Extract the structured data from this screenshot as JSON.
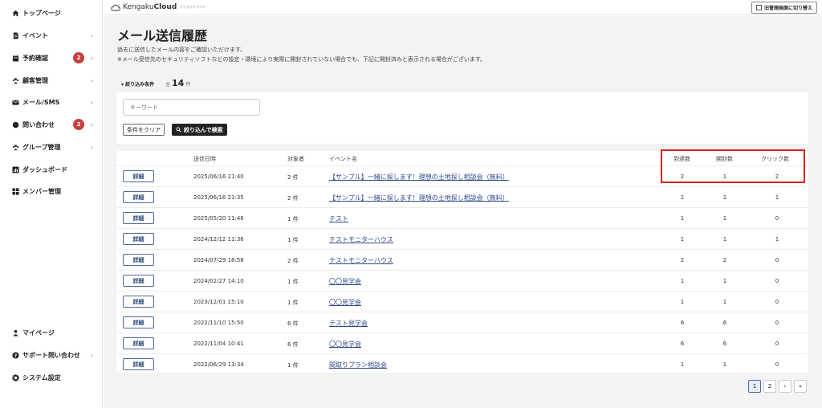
{
  "sidebar": {
    "items": [
      {
        "label": "トップページ",
        "icon": "home-icon"
      },
      {
        "label": "イベント",
        "icon": "document-icon",
        "chevron": "›"
      },
      {
        "label": "予約確認",
        "icon": "calendar-icon",
        "badge": "2",
        "chevron": "›"
      },
      {
        "label": "顧客管理",
        "icon": "users-icon",
        "chevron": "›"
      },
      {
        "label": "メール/SMS",
        "icon": "mail-icon",
        "chevron": "›"
      },
      {
        "label": "問い合わせ",
        "icon": "chat-icon",
        "badge": "2",
        "chevron": "›"
      },
      {
        "label": "グループ管理",
        "icon": "group-icon",
        "chevron": "›"
      },
      {
        "label": "ダッシュボード",
        "icon": "chart-icon"
      },
      {
        "label": "メンバー管理",
        "icon": "grid-icon"
      }
    ],
    "bottom_items": [
      {
        "label": "マイページ",
        "icon": "person-icon"
      },
      {
        "label": "サポート問い合わせ",
        "icon": "help-icon",
        "chevron": "›"
      },
      {
        "label": "システム設定",
        "icon": "gear-icon"
      }
    ]
  },
  "header": {
    "logo_main": "Kengaku",
    "logo_bold": "Cloud",
    "logo_sub": "ケンガククラウド",
    "switch_label": "旧管理画面に切り替え"
  },
  "main": {
    "title": "メール送信履歴",
    "desc1": "過去に送信したメール内容をご確認いただけます。",
    "desc2": "※メール受信先のセキュリティソフトなどの設定・環境により実際に開封されていない場合でも、下記に開封済みと表示される場合がございます。",
    "filter_label": "▾ 絞り込み条件",
    "total_prefix": "全",
    "total_count": "14",
    "total_suffix": "件",
    "keyword_placeholder": "キーワード",
    "clear_label": "条件をクリア",
    "search_label": "絞り込んで検索"
  },
  "table": {
    "headers": {
      "sent_at": "送信日時",
      "targets": "対象者",
      "event": "イベント名",
      "delivered": "到達数",
      "opened": "開封数",
      "clicks": "クリック数"
    },
    "detail_label": "詳細",
    "rows": [
      {
        "sent_at": "2025/06/16 21:40",
        "targets": "2 件",
        "event": "【サンプル】一緒に探します！理想の土地探し相談会（無料）",
        "delivered": "2",
        "opened": "1",
        "clicks": "2"
      },
      {
        "sent_at": "2025/06/16 21:35",
        "targets": "2 件",
        "event": "【サンプル】一緒に探します！理想の土地探し相談会（無料）",
        "delivered": "1",
        "opened": "1",
        "clicks": "1"
      },
      {
        "sent_at": "2025/05/20 11:46",
        "targets": "1 件",
        "event": "テスト",
        "delivered": "1",
        "opened": "1",
        "clicks": "0"
      },
      {
        "sent_at": "2024/12/12 11:36",
        "targets": "1 件",
        "event": "テストモニターハウス",
        "delivered": "1",
        "opened": "1",
        "clicks": "1"
      },
      {
        "sent_at": "2024/07/29 18:58",
        "targets": "2 件",
        "event": "テストモニターハウス",
        "delivered": "2",
        "opened": "2",
        "clicks": "0"
      },
      {
        "sent_at": "2024/02/27 14:10",
        "targets": "1 件",
        "event": "〇〇見学会",
        "delivered": "1",
        "opened": "1",
        "clicks": "0"
      },
      {
        "sent_at": "2023/12/01 15:10",
        "targets": "1 件",
        "event": "〇〇見学会",
        "delivered": "1",
        "opened": "1",
        "clicks": "0"
      },
      {
        "sent_at": "2022/11/10 15:50",
        "targets": "6 件",
        "event": "テスト見学会",
        "delivered": "6",
        "opened": "6",
        "clicks": "0"
      },
      {
        "sent_at": "2022/11/04 10:41",
        "targets": "6 件",
        "event": "〇〇見学会",
        "delivered": "6",
        "opened": "6",
        "clicks": "0"
      },
      {
        "sent_at": "2022/06/29 13:34",
        "targets": "1 件",
        "event": "間取りプラン相談会",
        "delivered": "1",
        "opened": "1",
        "clicks": "0"
      }
    ]
  },
  "pagination": {
    "pages": [
      "1",
      "2"
    ],
    "next": "›",
    "last": "»"
  },
  "colors": {
    "highlight": "#e01f1f",
    "badge": "#c8403e",
    "link": "#2c4a8a"
  }
}
